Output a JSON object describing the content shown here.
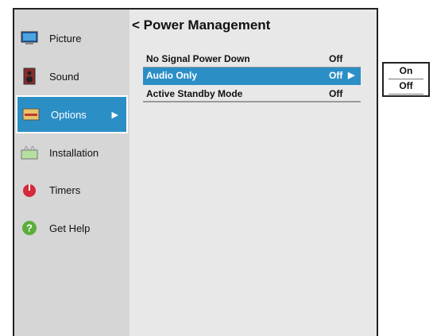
{
  "sidebar": {
    "items": [
      {
        "label": "Picture",
        "icon": "monitor-icon"
      },
      {
        "label": "Sound",
        "icon": "speaker-icon"
      },
      {
        "label": "Options",
        "icon": "options-icon",
        "active": true,
        "arrow": "▶"
      },
      {
        "label": "Installation",
        "icon": "installation-icon"
      },
      {
        "label": "Timers",
        "icon": "timer-icon"
      },
      {
        "label": "Get Help",
        "icon": "help-icon"
      }
    ]
  },
  "panel": {
    "back": "<",
    "title": "Power Management",
    "settings": [
      {
        "name": "No Signal Power Down",
        "value": "Off"
      },
      {
        "name": "Audio Only",
        "value": "Off",
        "arrow": "▶",
        "selected": true
      },
      {
        "name": "Active Standby Mode",
        "value": "Off"
      }
    ]
  },
  "popup": {
    "options": [
      "On",
      "Off"
    ]
  },
  "colors": {
    "accent": "#2b8fc6",
    "sidebar_bg": "#d6d6d6",
    "panel_bg": "#e8e8e8"
  }
}
